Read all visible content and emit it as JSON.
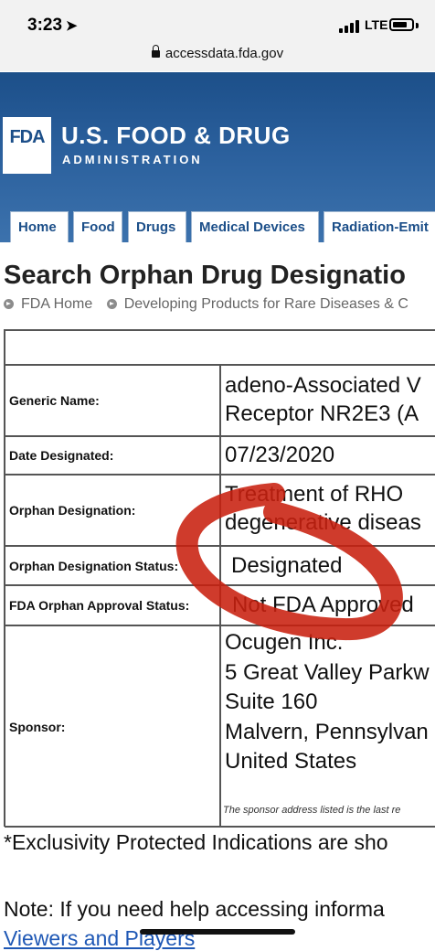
{
  "status_bar": {
    "time": "3:23",
    "time_icon": "location-arrow-icon",
    "network": "LTE",
    "signal_icon": "signal-bars-icon",
    "battery_icon": "battery-icon"
  },
  "browser": {
    "url": "accessdata.fda.gov",
    "lock_icon": "lock-icon"
  },
  "header": {
    "logo_text": "FDA",
    "agency_name": "U.S. FOOD & DRUG",
    "agency_sub": "ADMINISTRATION",
    "brand_color": "#1c4f89"
  },
  "nav": {
    "tabs": [
      {
        "label": "Home"
      },
      {
        "label": "Food"
      },
      {
        "label": "Drugs"
      },
      {
        "label": "Medical Devices"
      },
      {
        "label": "Radiation-Emit"
      }
    ]
  },
  "page": {
    "title": "Search Orphan Drug Designatio",
    "breadcrumbs": [
      {
        "label": "FDA Home"
      },
      {
        "label": "Developing Products for Rare Diseases & C"
      }
    ]
  },
  "details": {
    "generic_name_label": "Generic Name:",
    "generic_name_line1": "adeno-Associated V",
    "generic_name_line2": "Receptor NR2E3 (A",
    "date_label": "Date Designated:",
    "date_value": "07/23/2020",
    "designation_label": "Orphan Designation:",
    "designation_line1": "Treatment of RHO",
    "designation_line2": "degenerative diseas",
    "status_label": "Orphan Designation Status:",
    "status_value": "Designated",
    "approval_label": "FDA Orphan Approval Status:",
    "approval_value": "Not FDA Approved",
    "sponsor_label": "Sponsor:",
    "sponsor_lines": [
      "Ocugen Inc.",
      "5 Great Valley Parkw",
      "Suite 160",
      "Malvern, Pennsylvan",
      "United States"
    ],
    "sponsor_note": "The sponsor address listed is the last re",
    "annotation_color": "#c8200f"
  },
  "footer": {
    "exclusivity": "*Exclusivity Protected Indications are sho",
    "help_note": "Note: If you need help accessing informa",
    "viewers_link": "Viewers and Players"
  }
}
